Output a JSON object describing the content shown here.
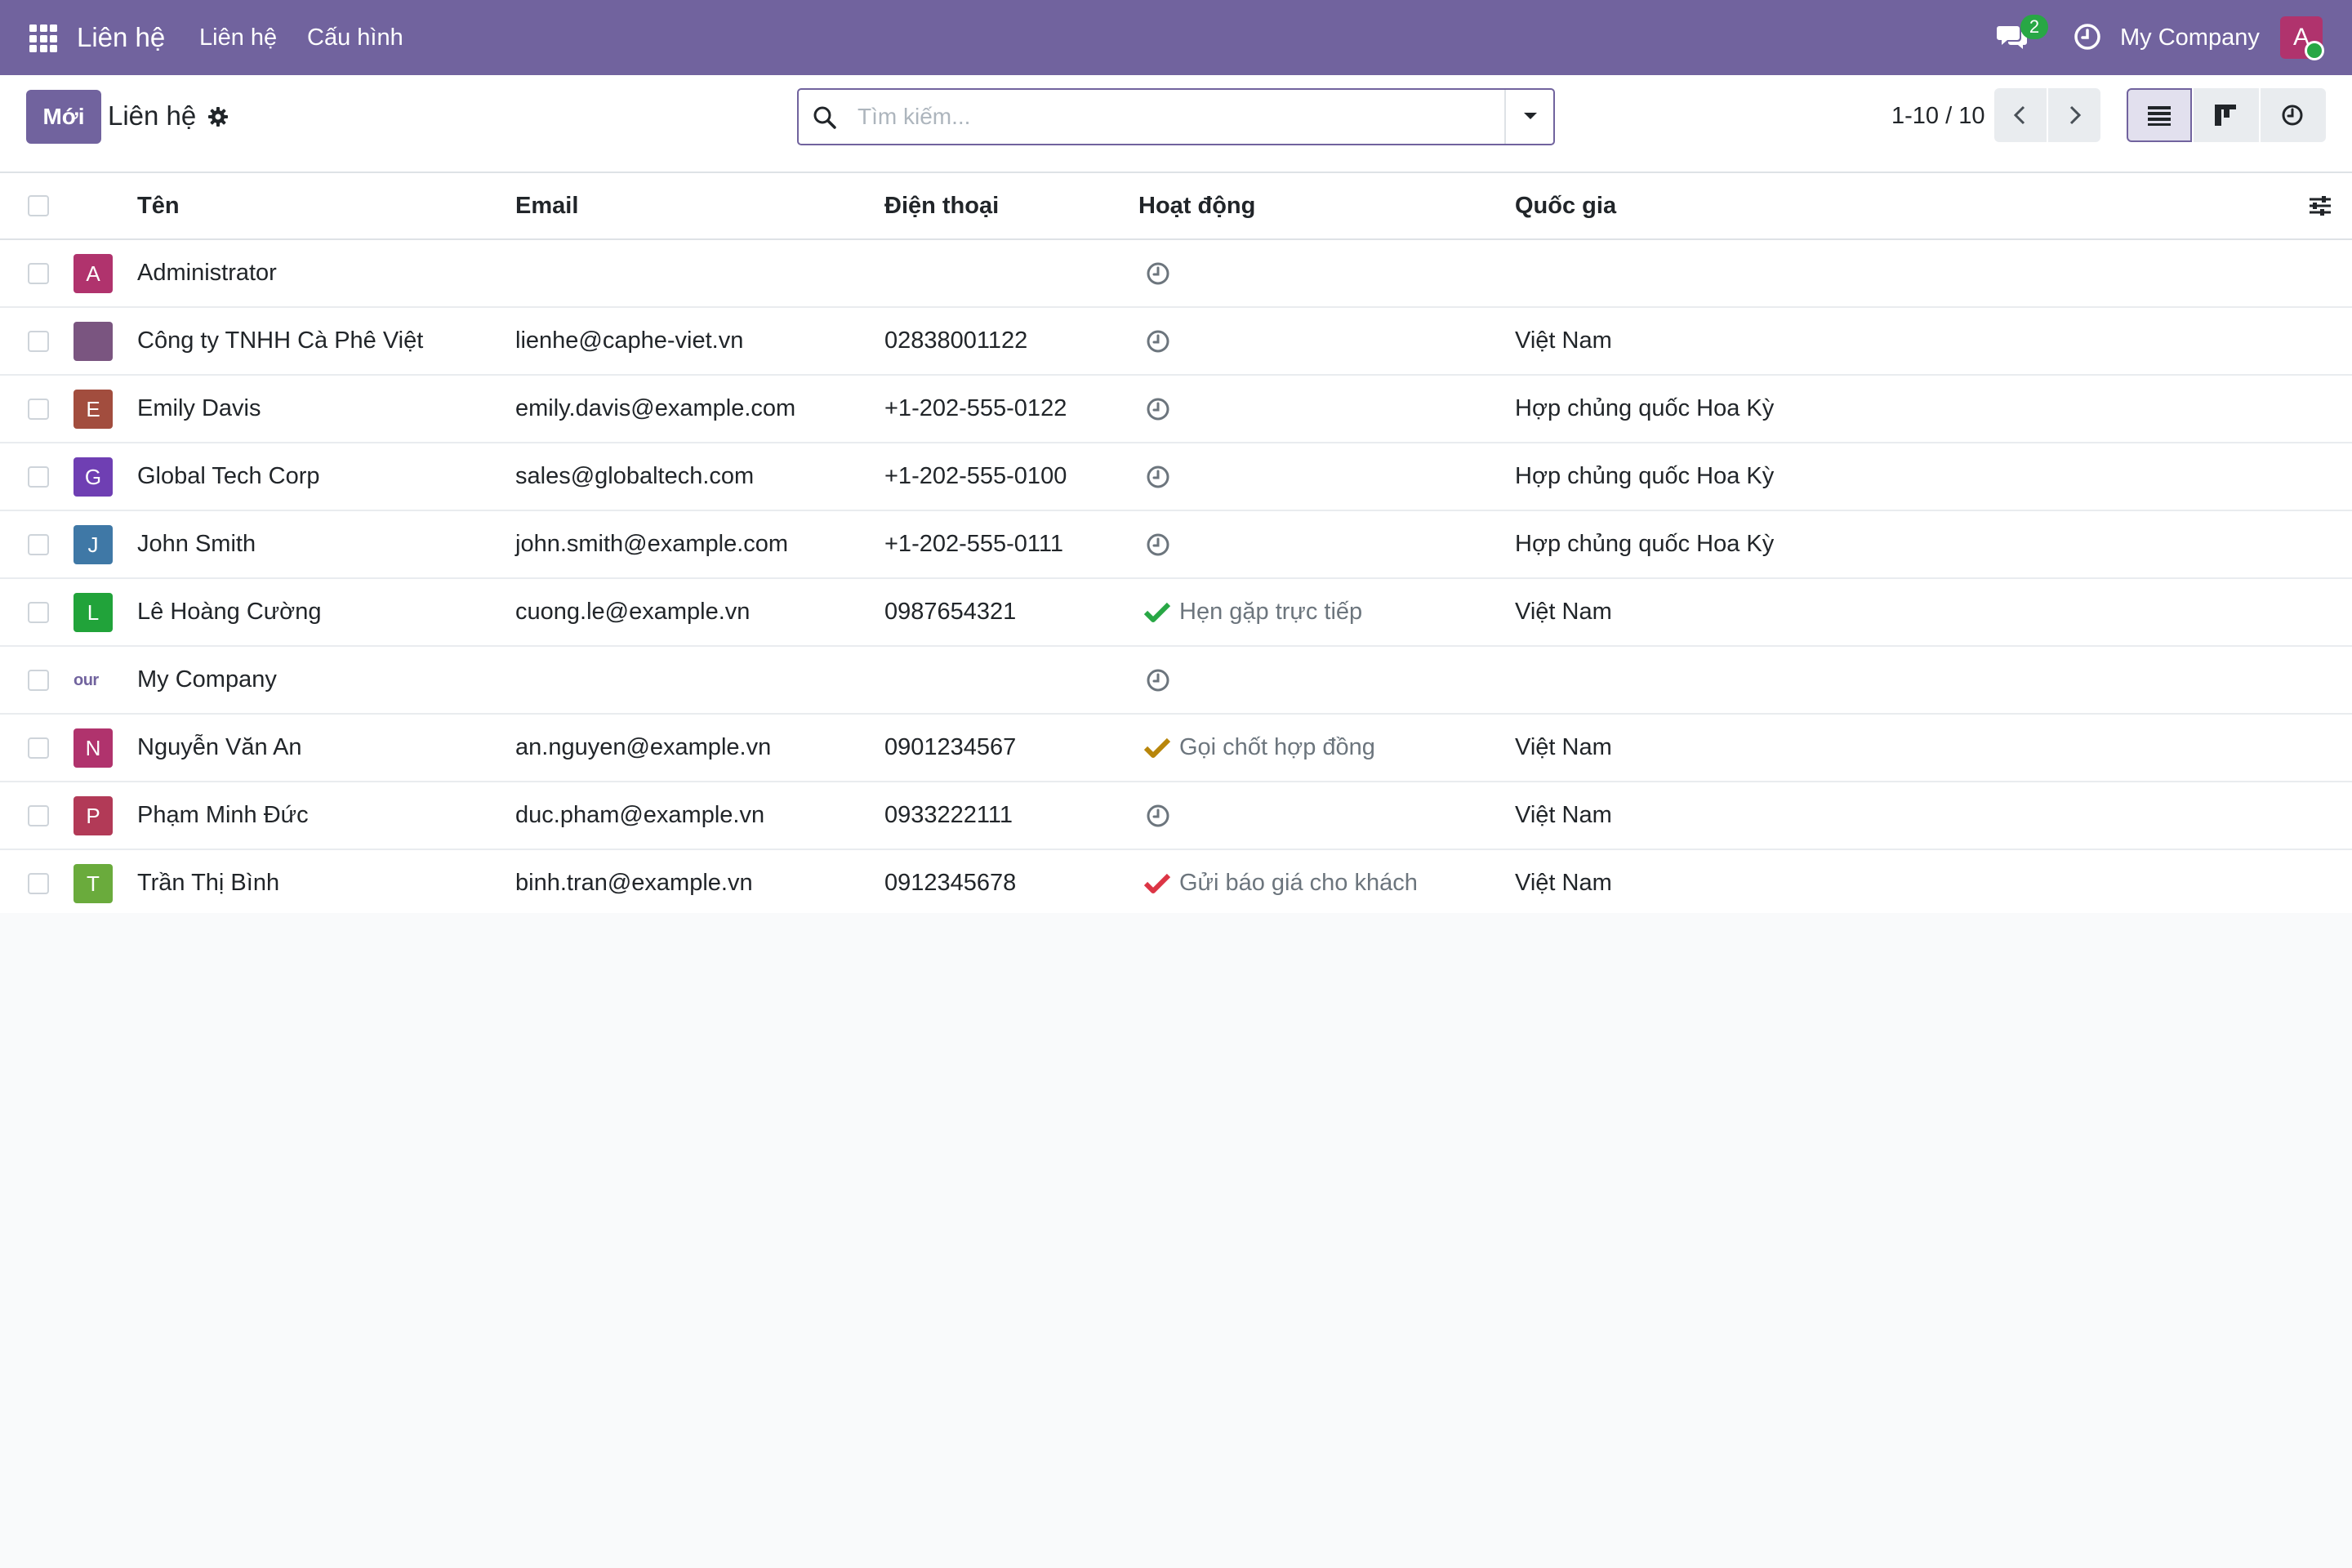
{
  "navbar": {
    "brand": "Liên hệ",
    "menus": [
      "Liên hệ",
      "Cấu hình"
    ],
    "chat_count": "2",
    "company": "My Company",
    "user_initial": "A"
  },
  "control": {
    "new_label": "Mới",
    "title": "Liên hệ",
    "search_placeholder": "Tìm kiếm...",
    "pager": "1-10 / 10"
  },
  "columns": {
    "name": "Tên",
    "email": "Email",
    "phone": "Điện thoại",
    "activity": "Hoạt động",
    "country": "Quốc gia"
  },
  "rows": [
    {
      "initial": "A",
      "color": "#b0336d",
      "name": "Administrator",
      "email": "",
      "phone": "",
      "activity": "",
      "activity_state": "none",
      "country": ""
    },
    {
      "initial": "",
      "color": "#7a5580",
      "name": "Công ty TNHH Cà Phê Việt",
      "email": "lienhe@caphe-viet.vn",
      "phone": "02838001122",
      "activity": "",
      "activity_state": "none",
      "country": "Việt Nam"
    },
    {
      "initial": "E",
      "color": "#a24d3e",
      "name": "Emily Davis",
      "email": "emily.davis@example.com",
      "phone": "+1-202-555-0122",
      "activity": "",
      "activity_state": "none",
      "country": "Hợp chủng quốc Hoa Kỳ"
    },
    {
      "initial": "G",
      "color": "#6f3fb3",
      "name": "Global Tech Corp",
      "email": "sales@globaltech.com",
      "phone": "+1-202-555-0100",
      "activity": "",
      "activity_state": "none",
      "country": "Hợp chủng quốc Hoa Kỳ"
    },
    {
      "initial": "J",
      "color": "#3f78a6",
      "name": "John Smith",
      "email": "john.smith@example.com",
      "phone": "+1-202-555-0111",
      "activity": "",
      "activity_state": "none",
      "country": "Hợp chủng quốc Hoa Kỳ"
    },
    {
      "initial": "L",
      "color": "#21a33a",
      "name": "Lê Hoàng Cường",
      "email": "cuong.le@example.vn",
      "phone": "0987654321",
      "activity": "Hẹn gặp trực tiếp",
      "activity_state": "planned",
      "country": "Việt Nam"
    },
    {
      "initial": "our",
      "color": "logo",
      "name": "My Company",
      "email": "",
      "phone": "",
      "activity": "",
      "activity_state": "none",
      "country": ""
    },
    {
      "initial": "N",
      "color": "#b0336d",
      "name": "Nguyễn Văn An",
      "email": "an.nguyen@example.vn",
      "phone": "0901234567",
      "activity": "Gọi chốt hợp đồng",
      "activity_state": "today",
      "country": "Việt Nam"
    },
    {
      "initial": "P",
      "color": "#b23a57",
      "name": "Phạm Minh Đức",
      "email": "duc.pham@example.vn",
      "phone": "0933222111",
      "activity": "",
      "activity_state": "none",
      "country": "Việt Nam"
    },
    {
      "initial": "T",
      "color": "#6aab3c",
      "name": "Trần Thị Bình",
      "email": "binh.tran@example.vn",
      "phone": "0912345678",
      "activity": "Gửi báo giá cho khách",
      "activity_state": "overdue",
      "country": "Việt Nam"
    }
  ],
  "activity_colors": {
    "planned": "#28a745",
    "today": "#b8860b",
    "overdue": "#dc3545",
    "none": "#6c757d"
  }
}
